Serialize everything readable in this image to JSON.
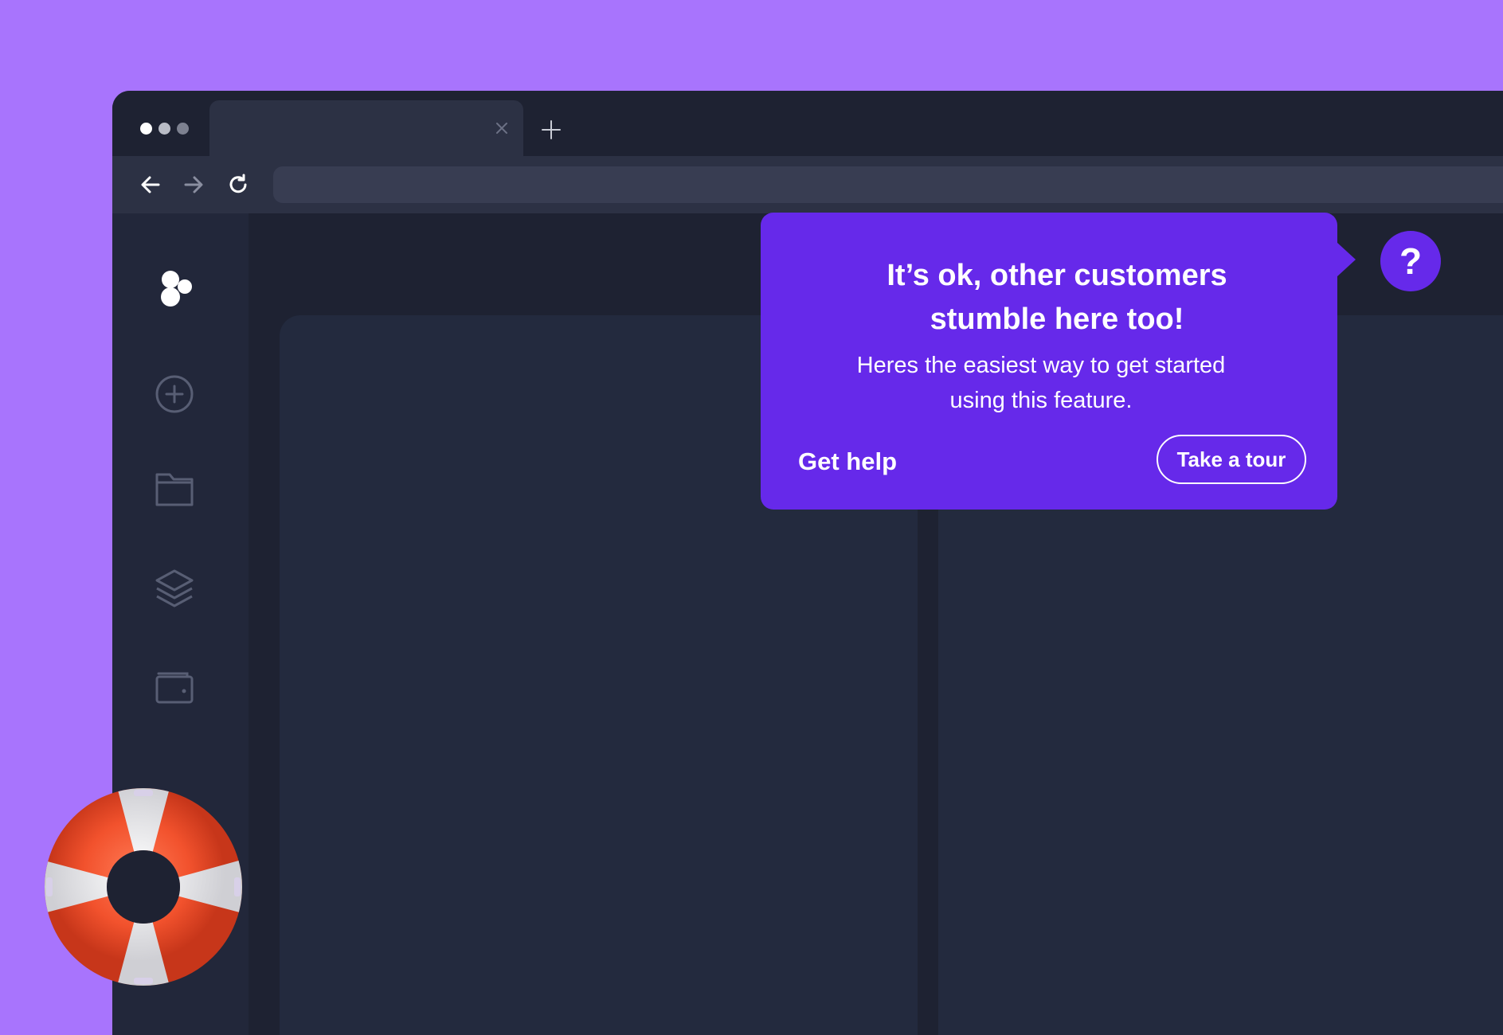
{
  "browser": {
    "tab_title": "",
    "address": ""
  },
  "popover": {
    "title": "It’s ok, other customers\nstumble here too!",
    "body": "Heres the easiest way to get started\nusing this feature.",
    "secondary_action": "Get help",
    "primary_action": "Take a tour"
  },
  "help_button": {
    "label": "?"
  },
  "sidebar": {
    "items": [
      {
        "icon": "logo-icon"
      },
      {
        "icon": "add-circle-icon"
      },
      {
        "icon": "folder-icon"
      },
      {
        "icon": "layers-icon"
      },
      {
        "icon": "wallet-icon"
      }
    ]
  },
  "colors": {
    "background": "#a874fd",
    "accent": "#6629ea",
    "window": "#1e2232"
  }
}
